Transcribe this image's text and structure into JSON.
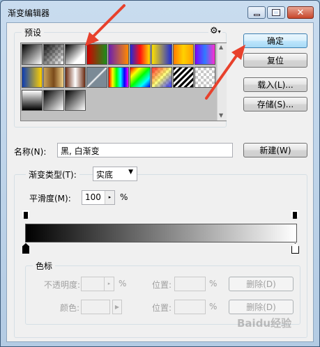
{
  "window": {
    "title": "渐变编辑器"
  },
  "presets": {
    "legend": "预设",
    "swatches": [
      "linear-gradient(to right bottom, #000, #fff)",
      "checker|linear-gradient(to right bottom, rgba(0,0,0,0.9), rgba(0,0,0,0))",
      "linear-gradient(to right bottom, #000, #fff 70%)",
      "linear-gradient(to right, #d20000, #1b8f1b)",
      "linear-gradient(to right, #6a1fb0, #ff8a00)",
      "linear-gradient(to right, #1f2bd8, #ff1010, #ffe100)",
      "linear-gradient(to right, #ffe100, #1f2bd8)",
      "linear-gradient(to right, #ff7a00, #ffd100, #ff9d00)",
      "linear-gradient(to right, #8000ff, #2f7bff, #ff2cd0)",
      "linear-gradient(to right, #0d3db3, #ffd000)",
      "linear-gradient(to right, #c9a35a, #7a4a1a, #f2d38a)",
      "linear-gradient(to right, #6b2b12, #ffffff, #6b2b12)",
      "linear-gradient(135deg, #7b8a96 45%, #fff 50%, #7b8a96 55%)",
      "linear-gradient(to right, #ff0000, #ffff00, #00ff00, #00ffff, #0000ff, #ff00ff)",
      "linear-gradient(135deg, #ff0000, #ffff00, #00ff00, #00ffff, #0000ff)",
      "checker|linear-gradient(135deg, rgba(255,0,0,0.8), rgba(255,255,0,0.5), rgba(0,0,255,0.8))",
      "repeating-linear-gradient(135deg, #000 0, #000 3px, #fff 3px, #fff 6px)",
      "checker|linear-gradient(to right, rgba(0,0,0,0), rgba(0,0,0,0))",
      "linear-gradient(to bottom, #fff, #000)",
      "linear-gradient(to right bottom, #000, #fff)",
      "linear-gradient(to right bottom, #000, #fff)"
    ]
  },
  "buttons": {
    "ok": "确定",
    "reset": "复位",
    "load": "载入(L)...",
    "save": "存储(S)...",
    "new": "新建(W)",
    "delete": "删除(D)"
  },
  "name": {
    "label": "名称(N):",
    "value": "黑, 白渐变"
  },
  "gradient_type": {
    "label": "渐变类型(T):",
    "value": "实底"
  },
  "smoothness": {
    "label": "平滑度(M):",
    "value": "100",
    "unit": "%"
  },
  "color_stops": {
    "legend": "色标",
    "opacity_label": "不透明度:",
    "color_label": "颜色:",
    "location_label": "位置:",
    "percent": "%"
  },
  "watermark": "Baidu经验"
}
